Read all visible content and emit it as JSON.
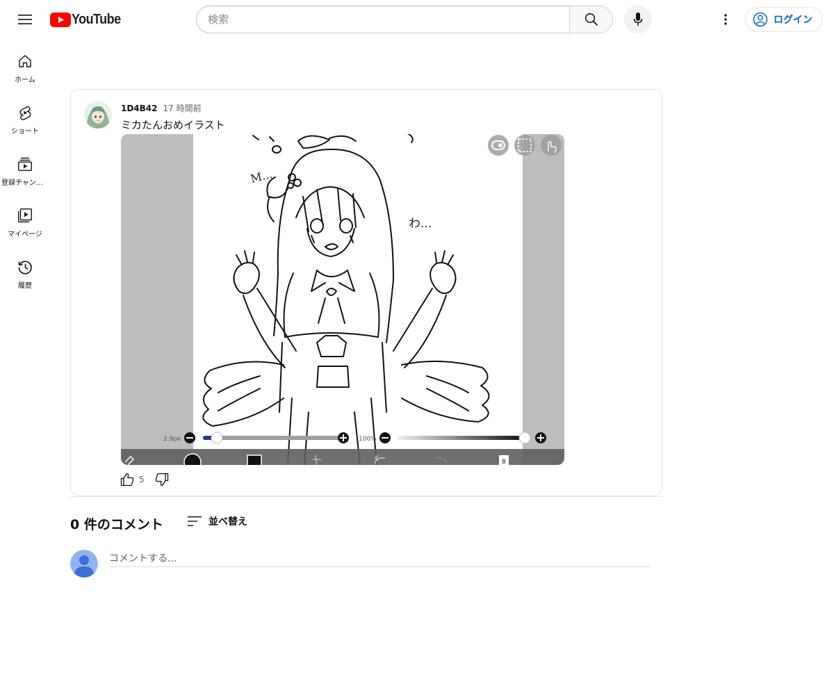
{
  "masthead": {
    "logo_text": "YouTube",
    "search_placeholder": "検索",
    "signin_label": "ログイン"
  },
  "guide": {
    "items": [
      {
        "label": "ホーム",
        "icon": "home-icon"
      },
      {
        "label": "ショート",
        "icon": "shorts-icon"
      },
      {
        "label": "登録チャンネル",
        "icon": "subscriptions-icon"
      },
      {
        "label": "マイページ",
        "icon": "you-icon"
      },
      {
        "label": "履歴",
        "icon": "history-icon"
      }
    ]
  },
  "post": {
    "author": "1D4B42",
    "time": "17 時間前",
    "text": "ミカたんおめイラスト",
    "likes": "5",
    "image_overlay": {
      "brush_size": "2.9px",
      "opacity": "100%",
      "layer_count": "8",
      "handwritten_text": [
        "M...",
        "わ..."
      ]
    }
  },
  "comments": {
    "count_label": "0 件のコメント",
    "sort_label": "並べ替え",
    "input_placeholder": "コメントする..."
  },
  "colors": {
    "brand_red": "#ff0000",
    "link_blue": "#065fd4",
    "border": "#e5e5e5",
    "secondary_text": "#606060"
  }
}
